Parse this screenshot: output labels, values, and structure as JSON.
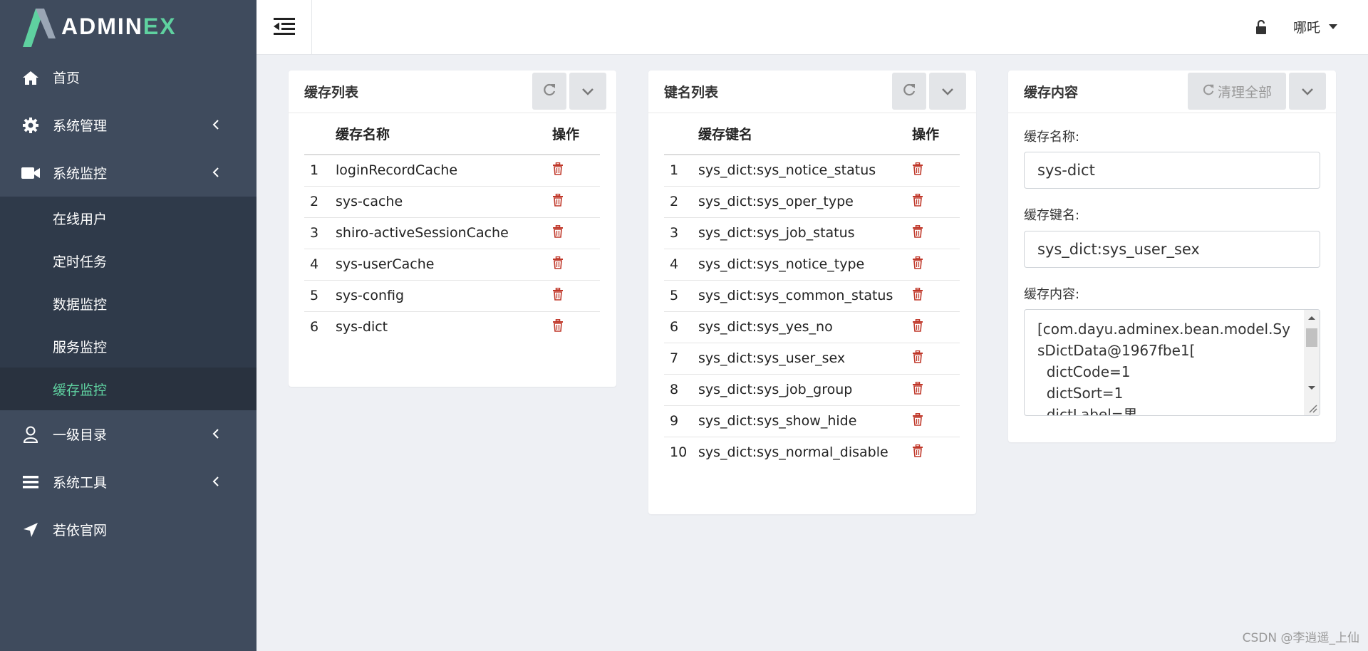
{
  "brand": {
    "name_main": "ADMIN",
    "name_accent": "EX"
  },
  "sidebar": {
    "items": [
      {
        "label": "首页",
        "icon": "home-icon"
      },
      {
        "label": "系统管理",
        "icon": "gear-icon"
      },
      {
        "label": "系统监控",
        "icon": "video-camera-icon"
      },
      {
        "label": "一级目录",
        "icon": "user-icon"
      },
      {
        "label": "系统工具",
        "icon": "bars-icon"
      },
      {
        "label": "若依官网",
        "icon": "location-arrow-icon"
      }
    ],
    "monitor_sub": [
      "在线用户",
      "定时任务",
      "数据监控",
      "服务监控",
      "缓存监控"
    ]
  },
  "topbar": {
    "username": "哪吒"
  },
  "cache_list": {
    "title": "缓存列表",
    "col_name": "缓存名称",
    "col_action": "操作",
    "rows": [
      {
        "no": "1",
        "name": "loginRecordCache"
      },
      {
        "no": "2",
        "name": "sys-cache"
      },
      {
        "no": "3",
        "name": "shiro-activeSessionCache"
      },
      {
        "no": "4",
        "name": "sys-userCache"
      },
      {
        "no": "5",
        "name": "sys-config"
      },
      {
        "no": "6",
        "name": "sys-dict"
      }
    ]
  },
  "key_list": {
    "title": "键名列表",
    "col_name": "缓存键名",
    "col_action": "操作",
    "rows": [
      {
        "no": "1",
        "name": "sys_dict:sys_notice_status"
      },
      {
        "no": "2",
        "name": "sys_dict:sys_oper_type"
      },
      {
        "no": "3",
        "name": "sys_dict:sys_job_status"
      },
      {
        "no": "4",
        "name": "sys_dict:sys_notice_type"
      },
      {
        "no": "5",
        "name": "sys_dict:sys_common_status"
      },
      {
        "no": "6",
        "name": "sys_dict:sys_yes_no"
      },
      {
        "no": "7",
        "name": "sys_dict:sys_user_sex"
      },
      {
        "no": "8",
        "name": "sys_dict:sys_job_group"
      },
      {
        "no": "9",
        "name": "sys_dict:sys_show_hide"
      },
      {
        "no": "10",
        "name": "sys_dict:sys_normal_disable"
      }
    ]
  },
  "cache_content": {
    "title": "缓存内容",
    "clear_all_label": "清理全部",
    "name_label": "缓存名称:",
    "name_value": "sys-dict",
    "key_label": "缓存键名:",
    "key_value": "sys_dict:sys_user_sex",
    "content_label": "缓存内容:",
    "content_value": "[com.dayu.adminex.bean.model.SysDictData@1967fbe1[\n  dictCode=1\n  dictSort=1\n  dictLabel=男"
  },
  "watermark": "CSDN @李逍遥_上仙",
  "colors": {
    "sidebar": "#3f4b5d",
    "submenu": "#2f3a4a",
    "accent": "#5fd1a0",
    "delete": "#c0392b"
  }
}
